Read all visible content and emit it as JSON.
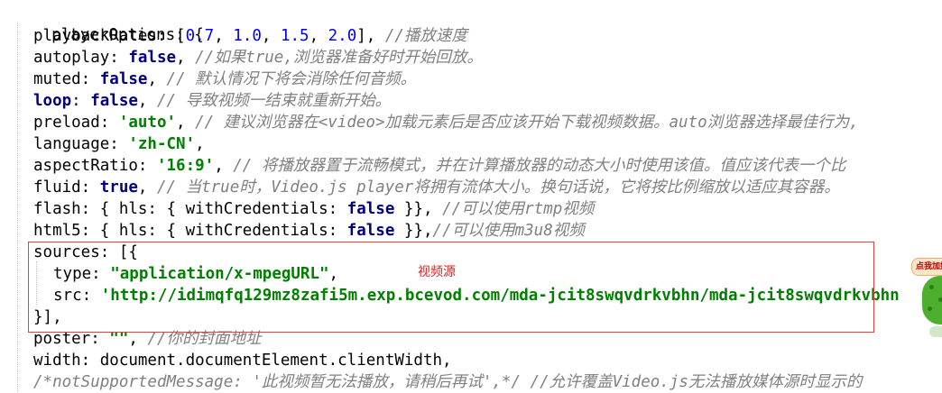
{
  "code": {
    "header": "playerOptions: {",
    "playbackRates_key": "playbackRates: [",
    "playbackRates_values": [
      "0.7",
      "1.0",
      "1.5",
      "2.0"
    ],
    "playbackRates_end": "], ",
    "playbackRates_comment": "//播放速度",
    "autoplay_key": "autoplay: ",
    "autoplay_value": "false",
    "autoplay_comment": "//如果true,浏览器准备好时开始回放。",
    "muted_key": "muted: ",
    "muted_value": "false",
    "muted_comment": "// 默认情况下将会消除任何音频。",
    "loop_key": "loop",
    "loop_value": "false",
    "loop_comment": "// 导致视频一结束就重新开始。",
    "preload_key": "preload: ",
    "preload_value": "'auto'",
    "preload_comment": "// 建议浏览器在<video>加载元素后是否应该开始下载视频数据。auto浏览器选择最佳行为,",
    "language_key": "language: ",
    "language_value": "'zh-CN'",
    "aspectRatio_key": "aspectRatio: ",
    "aspectRatio_value": "'16:9'",
    "aspectRatio_comment": "// 将播放器置于流畅模式，并在计算播放器的动态大小时使用该值。值应该代表一个比",
    "fluid_key": "fluid: ",
    "fluid_value": "true",
    "fluid_comment": "// 当true时，Video.js player将拥有流体大小。换句话说，它将按比例缩放以适应其容器。",
    "flash_pre": "flash: { hls: { withCredentials: ",
    "flash_value": "false",
    "flash_post": " }}, ",
    "flash_comment": "//可以使用rtmp视频",
    "html5_pre": "html5: { hls: { withCredentials: ",
    "html5_value": "false",
    "html5_post": " }},",
    "html5_comment": "//可以使用m3u8视频",
    "sources_open": "sources: [{",
    "type_key": "type: ",
    "type_value": "\"application/x-mpegURL\"",
    "src_key": "src: ",
    "src_value": "'http://idimqfq129mz8zafi5m.exp.bcevod.com/mda-jcit8swqvdrkvbhn/mda-jcit8swqvdrkvbhn",
    "sources_close": "}],",
    "poster_key": "poster: ",
    "poster_value": "\"\"",
    "poster_comment": "//你的封面地址",
    "width_line": "width: document.documentElement.clientWidth,",
    "notsupported_comment": "/*notSupportedMessage: '此视频暂无法播放，请稍后再试',*/ //允许覆盖Video.js无法播放媒体源时显示的"
  },
  "annotation": {
    "label": "视频源",
    "color": "#e02020"
  },
  "widget": {
    "badge": "点我加好友"
  },
  "colors": {
    "keyword": "#000080",
    "number": "#0000ff",
    "string": "#008000",
    "comment": "#808080",
    "highlight_box": "#e04040"
  }
}
